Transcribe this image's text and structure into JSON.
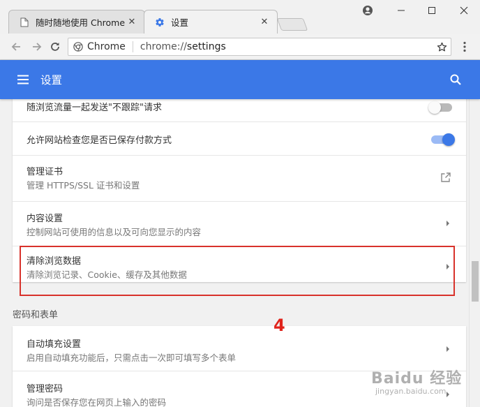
{
  "browser": {
    "tabs": [
      {
        "title": "随时随地使用 Chrome",
        "icon": "page-icon",
        "close": "✕"
      },
      {
        "title": "设置",
        "icon": "settings-gear-icon",
        "close": "✕"
      }
    ],
    "address": {
      "chip_label": "Chrome",
      "url_scheme": "chrome://",
      "url_host": "settings"
    }
  },
  "appbar": {
    "title": "设置",
    "color": "#3b78e7"
  },
  "privacy_rows": [
    {
      "title": "随浏览流量一起发送\"不跟踪\"请求",
      "subtitle": "",
      "control": "toggle",
      "checked": false
    },
    {
      "title": "允许网站检查您是否已保存付款方式",
      "subtitle": "",
      "control": "toggle",
      "checked": true
    },
    {
      "title": "管理证书",
      "subtitle": "管理 HTTPS/SSL 证书和设置",
      "control": "external-link-icon"
    },
    {
      "title": "内容设置",
      "subtitle": "控制网站可使用的信息以及可向您显示的内容",
      "control": "arrow-right-icon"
    },
    {
      "title": "清除浏览数据",
      "subtitle": "清除浏览记录、Cookie、缓存及其他数据",
      "control": "arrow-right-icon"
    }
  ],
  "section_heading": "密码和表单",
  "password_rows": [
    {
      "title": "自动填充设置",
      "subtitle": "启用自动填充功能后，只需点击一次即可填写多个表单",
      "control": "arrow-right-icon"
    },
    {
      "title": "管理密码",
      "subtitle": "询问是否保存您在网页上输入的密码",
      "control": "arrow-right-icon"
    }
  ],
  "annotation": {
    "step_number": "4",
    "color": "#d8322b"
  },
  "watermark": {
    "main": "Baidu 经验",
    "sub": "jingyan.baidu.com"
  }
}
